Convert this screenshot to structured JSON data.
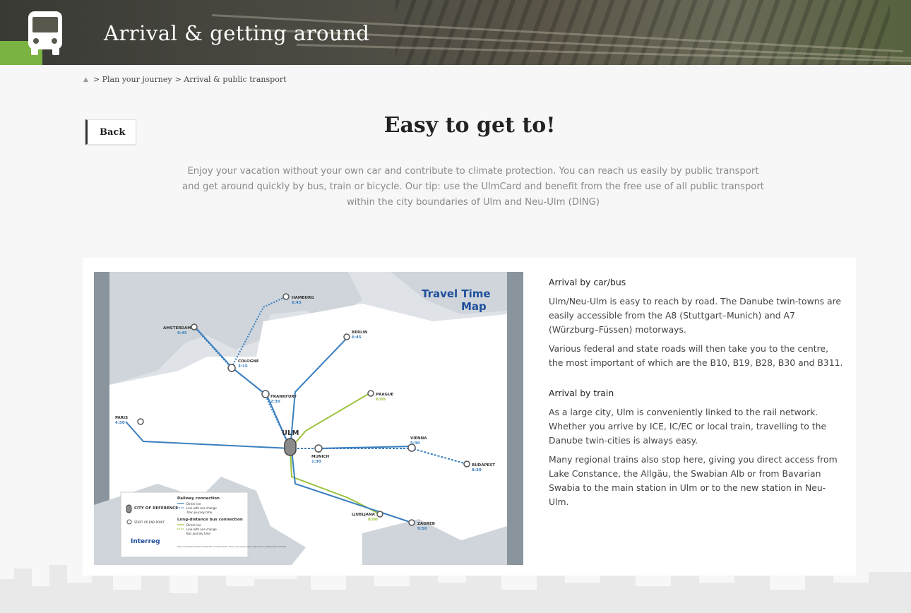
{
  "header": {
    "title": "Arrival & getting around",
    "icon": "bus-icon",
    "accent_color": "#7bb342"
  },
  "breadcrumb": {
    "home_icon": "home-icon",
    "items": [
      "> Plan your journey",
      "> Arrival & public transport"
    ]
  },
  "back_button": {
    "label": "Back"
  },
  "page": {
    "title": "Easy to get to!",
    "intro": "Enjoy your vacation without your own car and contribute to climate protection. You can reach us easily by public transport and get around quickly by bus, train or bicycle. Our tip: use the UlmCard and benefit from the free use of all public transport within the city boundaries of Ulm and Neu-Ulm (DING)"
  },
  "map": {
    "title_line1": "Travel Time",
    "title_line2": "Map",
    "center": "ULM",
    "cities": [
      {
        "name": "HAMBURG",
        "time": "6:45"
      },
      {
        "name": "AMSTERDAM",
        "time": "6:45"
      },
      {
        "name": "BERLIN",
        "time": "6:45"
      },
      {
        "name": "COLOGNE",
        "time": "3:15"
      },
      {
        "name": "FRANKFURT",
        "time": "2:30"
      },
      {
        "name": "PRAGUE",
        "time": "6:00"
      },
      {
        "name": "PARIS",
        "time": "4:50"
      },
      {
        "name": "VIENNA",
        "time": "5:30"
      },
      {
        "name": "MUNICH",
        "time": "1:30"
      },
      {
        "name": "BUDAPEST",
        "time": "8:30"
      },
      {
        "name": "LJUBLJANA",
        "time": "8:00"
      },
      {
        "name": "ZAGREB",
        "time": "9:50"
      }
    ],
    "legend": {
      "city_of_reference": "CITY OF REFERENCE",
      "start_end_point": "START OR END POINT",
      "railway_title": "Railway connection",
      "railway_items": [
        "Direct line",
        "Line with one change",
        "Train journey time"
      ],
      "bus_title": "Long-distance bus connection",
      "bus_items": [
        "Direct line",
        "Line with one change",
        "Bus journey time"
      ],
      "note": "The connections show a selection of main lines. There are many other options for sustainable mobility.",
      "logo": "Interreg"
    }
  },
  "sections": [
    {
      "heading": "Arrival by car/bus",
      "paragraphs": [
        "Ulm/Neu-Ulm is easy to reach by road. The Danube twin-towns are easily accessible from the A8 (Stuttgart–Munich) and A7 (Würzburg–Füssen) motorways.",
        "Various federal and state roads will then take you to the centre, the most important of which are the B10, B19, B28, B30 and B311."
      ]
    },
    {
      "heading": "Arrival by train",
      "paragraphs": [
        "As a large city, Ulm is conveniently linked to the rail network. Whether you arrive by ICE, IC/EC or local train, travelling to the Danube twin-cities is always easy.",
        "Many regional trains also stop here, giving you direct access from Lake Constance, the Allgäu, the Swabian Alb or from Bavarian Swabia to the main station in Ulm or to the new station in Neu-Ulm."
      ]
    }
  ],
  "colors": {
    "rail_blue": "#3a7fbf",
    "bus_green": "#9bc23c",
    "map_title": "#1f4e9c"
  }
}
